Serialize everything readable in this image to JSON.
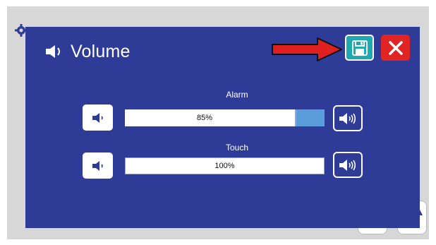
{
  "dialog": {
    "title": "Volume",
    "title_icon": "speaker-icon",
    "save_icon": "floppy-disk-icon",
    "close_icon": "close-x-icon"
  },
  "settings": [
    {
      "label": "Alarm",
      "value_text": "85%",
      "value": 85
    },
    {
      "label": "Touch",
      "value_text": "100%",
      "value": 100
    }
  ],
  "icons": {
    "volume_down": "speaker-low-icon",
    "volume_up": "speaker-high-icon"
  },
  "colors": {
    "dialog_bg": "#2e3c97",
    "save_button": "#1fa9b0",
    "close_button": "#e02424",
    "bar_remaining": "#5b9ddb",
    "annotation_arrow": "#e02020"
  }
}
